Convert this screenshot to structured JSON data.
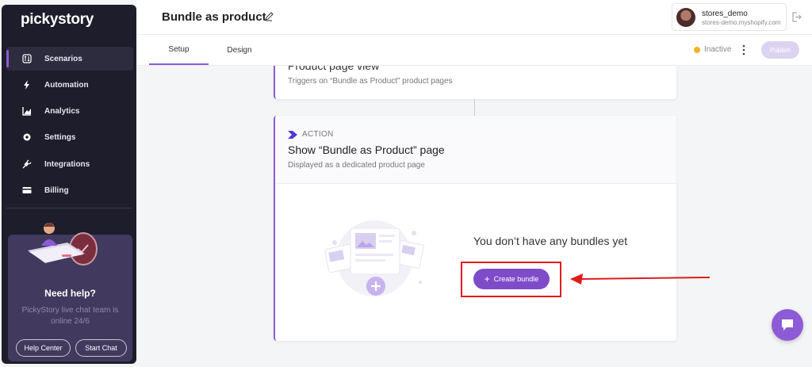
{
  "app": {
    "logo_text": "pickystory"
  },
  "sidebar": {
    "items": [
      {
        "label": "Scenarios",
        "icon": "scenarios-icon",
        "active": true
      },
      {
        "label": "Automation",
        "icon": "bolt-icon",
        "active": false
      },
      {
        "label": "Analytics",
        "icon": "chart-icon",
        "active": false
      },
      {
        "label": "Settings",
        "icon": "gear-icon",
        "active": false
      },
      {
        "label": "Integrations",
        "icon": "plug-icon",
        "active": false
      },
      {
        "label": "Billing",
        "icon": "card-icon",
        "active": false
      }
    ],
    "help": {
      "title": "Need help?",
      "subtitle": "PickyStory live chat team is online 24/6",
      "help_center_label": "Help Center",
      "start_chat_label": "Start Chat"
    }
  },
  "header": {
    "title": "Bundle as product",
    "user": {
      "name": "stores_demo",
      "domain": "stores-demo.myshopify.com"
    }
  },
  "tabs": [
    {
      "label": "Setup",
      "active": true
    },
    {
      "label": "Design",
      "active": false
    }
  ],
  "status": {
    "label": "Inactive",
    "color": "#f1b324"
  },
  "publish_label": "Publish",
  "trigger": {
    "title": "Product page view",
    "subtitle": "Triggers on “Bundle as Product” product pages"
  },
  "action": {
    "label": "ACTION",
    "title": "Show “Bundle as Product” page",
    "subtitle": "Displayed as a dedicated product page",
    "empty_text": "You don’t have any bundles yet",
    "create_label": "Create bundle"
  },
  "colors": {
    "accent": "#8e5bd6",
    "sidebar_bg": "#1d1d2b",
    "annotation": "#e21b1b"
  }
}
